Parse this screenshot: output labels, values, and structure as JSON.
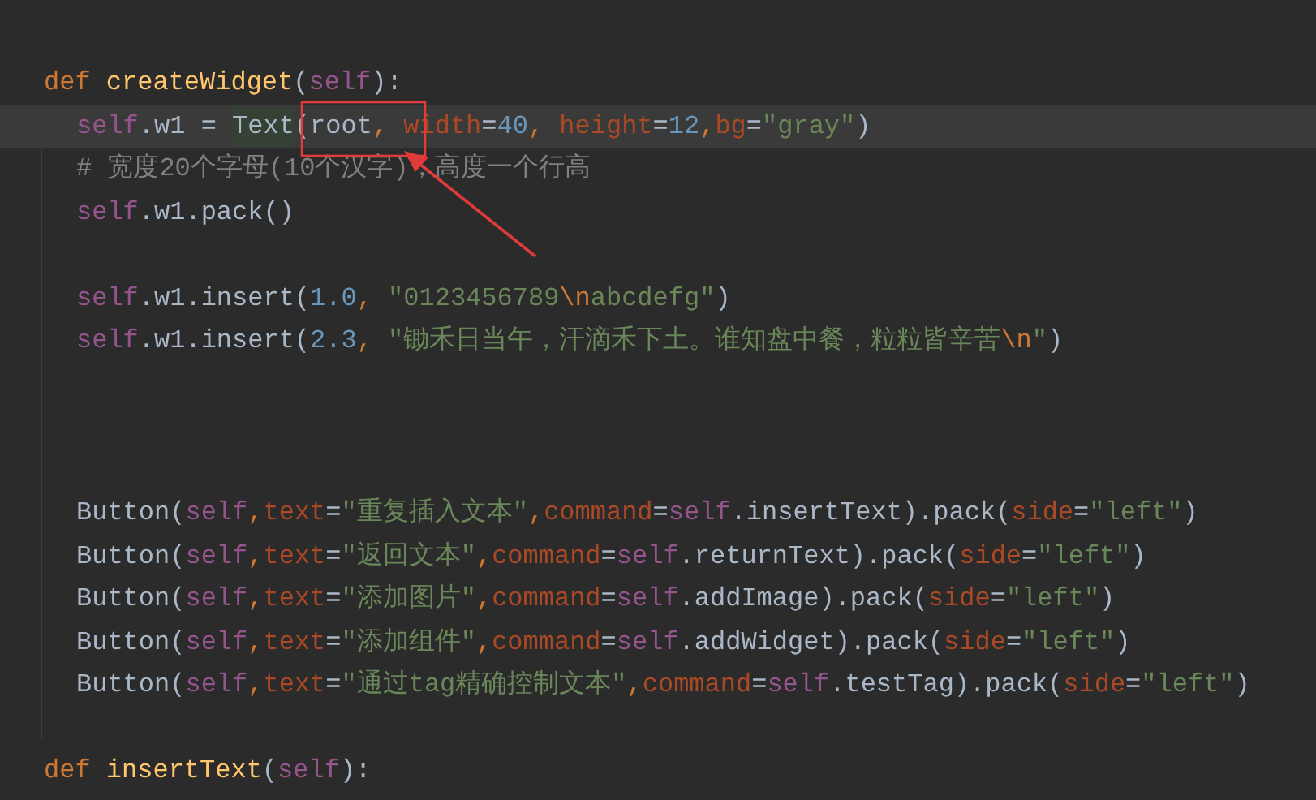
{
  "editor": {
    "lines": [
      {
        "kind": "def",
        "current": false,
        "tokens": [
          {
            "kind": "kw",
            "text": "def "
          },
          {
            "kind": "name",
            "text": "createWidget"
          },
          {
            "kind": "plain",
            "text": "("
          },
          {
            "kind": "self",
            "text": "self"
          },
          {
            "kind": "plain",
            "text": "):"
          }
        ]
      },
      {
        "kind": "body",
        "current": true,
        "tokens": [
          {
            "kind": "self",
            "text": "self"
          },
          {
            "kind": "plain",
            "text": ".w1 = "
          },
          {
            "kind": "match",
            "text": "Text"
          },
          {
            "kind": "plain",
            "text": "(root"
          },
          {
            "kind": "kw",
            "text": ", "
          },
          {
            "kind": "param",
            "text": "width"
          },
          {
            "kind": "plain",
            "text": "="
          },
          {
            "kind": "num",
            "text": "40"
          },
          {
            "kind": "kw",
            "text": ", "
          },
          {
            "kind": "param",
            "text": "height"
          },
          {
            "kind": "plain",
            "text": "="
          },
          {
            "kind": "num",
            "text": "12"
          },
          {
            "kind": "kw",
            "text": ","
          },
          {
            "kind": "param",
            "text": "bg"
          },
          {
            "kind": "plain",
            "text": "="
          },
          {
            "kind": "str",
            "text": "\"gray\""
          },
          {
            "kind": "plain",
            "text": ")"
          }
        ]
      },
      {
        "kind": "body",
        "current": false,
        "tokens": [
          {
            "kind": "comment",
            "text": "# 宽度20个字母(10个汉字)，高度一个行高"
          }
        ]
      },
      {
        "kind": "body",
        "current": false,
        "tokens": [
          {
            "kind": "self",
            "text": "self"
          },
          {
            "kind": "plain",
            "text": ".w1.pack()"
          }
        ]
      },
      {
        "kind": "blank",
        "current": false
      },
      {
        "kind": "body",
        "current": false,
        "tokens": [
          {
            "kind": "self",
            "text": "self"
          },
          {
            "kind": "plain",
            "text": ".w1.insert("
          },
          {
            "kind": "num",
            "text": "1.0"
          },
          {
            "kind": "kw",
            "text": ", "
          },
          {
            "kind": "str",
            "text": "\"0123456789"
          },
          {
            "kind": "esc",
            "text": "\\n"
          },
          {
            "kind": "str",
            "text": "abcdefg\""
          },
          {
            "kind": "plain",
            "text": ")"
          }
        ]
      },
      {
        "kind": "body",
        "current": false,
        "tokens": [
          {
            "kind": "self",
            "text": "self"
          },
          {
            "kind": "plain",
            "text": ".w1.insert("
          },
          {
            "kind": "num",
            "text": "2.3"
          },
          {
            "kind": "kw",
            "text": ", "
          },
          {
            "kind": "str",
            "text": "\"锄禾日当午，汗滴禾下土。谁知盘中餐，粒粒皆辛苦"
          },
          {
            "kind": "esc",
            "text": "\\n"
          },
          {
            "kind": "str",
            "text": "\""
          },
          {
            "kind": "plain",
            "text": ")"
          }
        ]
      },
      {
        "kind": "blank",
        "current": false
      },
      {
        "kind": "blank",
        "current": false
      },
      {
        "kind": "blank",
        "current": false
      },
      {
        "kind": "body",
        "current": false,
        "tokens": [
          {
            "kind": "plain",
            "text": "Button("
          },
          {
            "kind": "self",
            "text": "self"
          },
          {
            "kind": "kw",
            "text": ","
          },
          {
            "kind": "param",
            "text": "text"
          },
          {
            "kind": "plain",
            "text": "="
          },
          {
            "kind": "str",
            "text": "\"重复插入文本\""
          },
          {
            "kind": "kw",
            "text": ","
          },
          {
            "kind": "param",
            "text": "command"
          },
          {
            "kind": "plain",
            "text": "="
          },
          {
            "kind": "self",
            "text": "self"
          },
          {
            "kind": "plain",
            "text": ".insertText).pack("
          },
          {
            "kind": "param",
            "text": "side"
          },
          {
            "kind": "plain",
            "text": "="
          },
          {
            "kind": "str",
            "text": "\"left\""
          },
          {
            "kind": "plain",
            "text": ")"
          }
        ]
      },
      {
        "kind": "body",
        "current": false,
        "tokens": [
          {
            "kind": "plain",
            "text": "Button("
          },
          {
            "kind": "self",
            "text": "self"
          },
          {
            "kind": "kw",
            "text": ","
          },
          {
            "kind": "param",
            "text": "text"
          },
          {
            "kind": "plain",
            "text": "="
          },
          {
            "kind": "str",
            "text": "\"返回文本\""
          },
          {
            "kind": "kw",
            "text": ","
          },
          {
            "kind": "param",
            "text": "command"
          },
          {
            "kind": "plain",
            "text": "="
          },
          {
            "kind": "self",
            "text": "self"
          },
          {
            "kind": "plain",
            "text": ".returnText).pack("
          },
          {
            "kind": "param",
            "text": "side"
          },
          {
            "kind": "plain",
            "text": "="
          },
          {
            "kind": "str",
            "text": "\"left\""
          },
          {
            "kind": "plain",
            "text": ")"
          }
        ]
      },
      {
        "kind": "body",
        "current": false,
        "tokens": [
          {
            "kind": "plain",
            "text": "Button("
          },
          {
            "kind": "self",
            "text": "self"
          },
          {
            "kind": "kw",
            "text": ","
          },
          {
            "kind": "param",
            "text": "text"
          },
          {
            "kind": "plain",
            "text": "="
          },
          {
            "kind": "str",
            "text": "\"添加图片\""
          },
          {
            "kind": "kw",
            "text": ","
          },
          {
            "kind": "param",
            "text": "command"
          },
          {
            "kind": "plain",
            "text": "="
          },
          {
            "kind": "self",
            "text": "self"
          },
          {
            "kind": "plain",
            "text": ".addImage).pack("
          },
          {
            "kind": "param",
            "text": "side"
          },
          {
            "kind": "plain",
            "text": "="
          },
          {
            "kind": "str",
            "text": "\"left\""
          },
          {
            "kind": "plain",
            "text": ")"
          }
        ]
      },
      {
        "kind": "body",
        "current": false,
        "tokens": [
          {
            "kind": "plain",
            "text": "Button("
          },
          {
            "kind": "self",
            "text": "self"
          },
          {
            "kind": "kw",
            "text": ","
          },
          {
            "kind": "param",
            "text": "text"
          },
          {
            "kind": "plain",
            "text": "="
          },
          {
            "kind": "str",
            "text": "\"添加组件\""
          },
          {
            "kind": "kw",
            "text": ","
          },
          {
            "kind": "param",
            "text": "command"
          },
          {
            "kind": "plain",
            "text": "="
          },
          {
            "kind": "self",
            "text": "self"
          },
          {
            "kind": "plain",
            "text": ".addWidget).pack("
          },
          {
            "kind": "param",
            "text": "side"
          },
          {
            "kind": "plain",
            "text": "="
          },
          {
            "kind": "str",
            "text": "\"left\""
          },
          {
            "kind": "plain",
            "text": ")"
          }
        ]
      },
      {
        "kind": "body",
        "current": false,
        "tokens": [
          {
            "kind": "plain",
            "text": "Button("
          },
          {
            "kind": "self",
            "text": "self"
          },
          {
            "kind": "kw",
            "text": ","
          },
          {
            "kind": "param",
            "text": "text"
          },
          {
            "kind": "plain",
            "text": "="
          },
          {
            "kind": "str",
            "text": "\"通过tag精确控制文本\""
          },
          {
            "kind": "kw",
            "text": ","
          },
          {
            "kind": "param",
            "text": "command"
          },
          {
            "kind": "plain",
            "text": "="
          },
          {
            "kind": "self",
            "text": "self"
          },
          {
            "kind": "plain",
            "text": ".testTag).pack("
          },
          {
            "kind": "param",
            "text": "side"
          },
          {
            "kind": "plain",
            "text": "="
          },
          {
            "kind": "str",
            "text": "\"left\""
          },
          {
            "kind": "plain",
            "text": ")"
          }
        ]
      },
      {
        "kind": "blank",
        "current": false
      },
      {
        "kind": "def",
        "current": false,
        "tokens": [
          {
            "kind": "kw",
            "text": "def "
          },
          {
            "kind": "name",
            "text": "insertText"
          },
          {
            "kind": "plain",
            "text": "("
          },
          {
            "kind": "self",
            "text": "self"
          },
          {
            "kind": "plain",
            "text": "):"
          }
        ]
      }
    ]
  }
}
